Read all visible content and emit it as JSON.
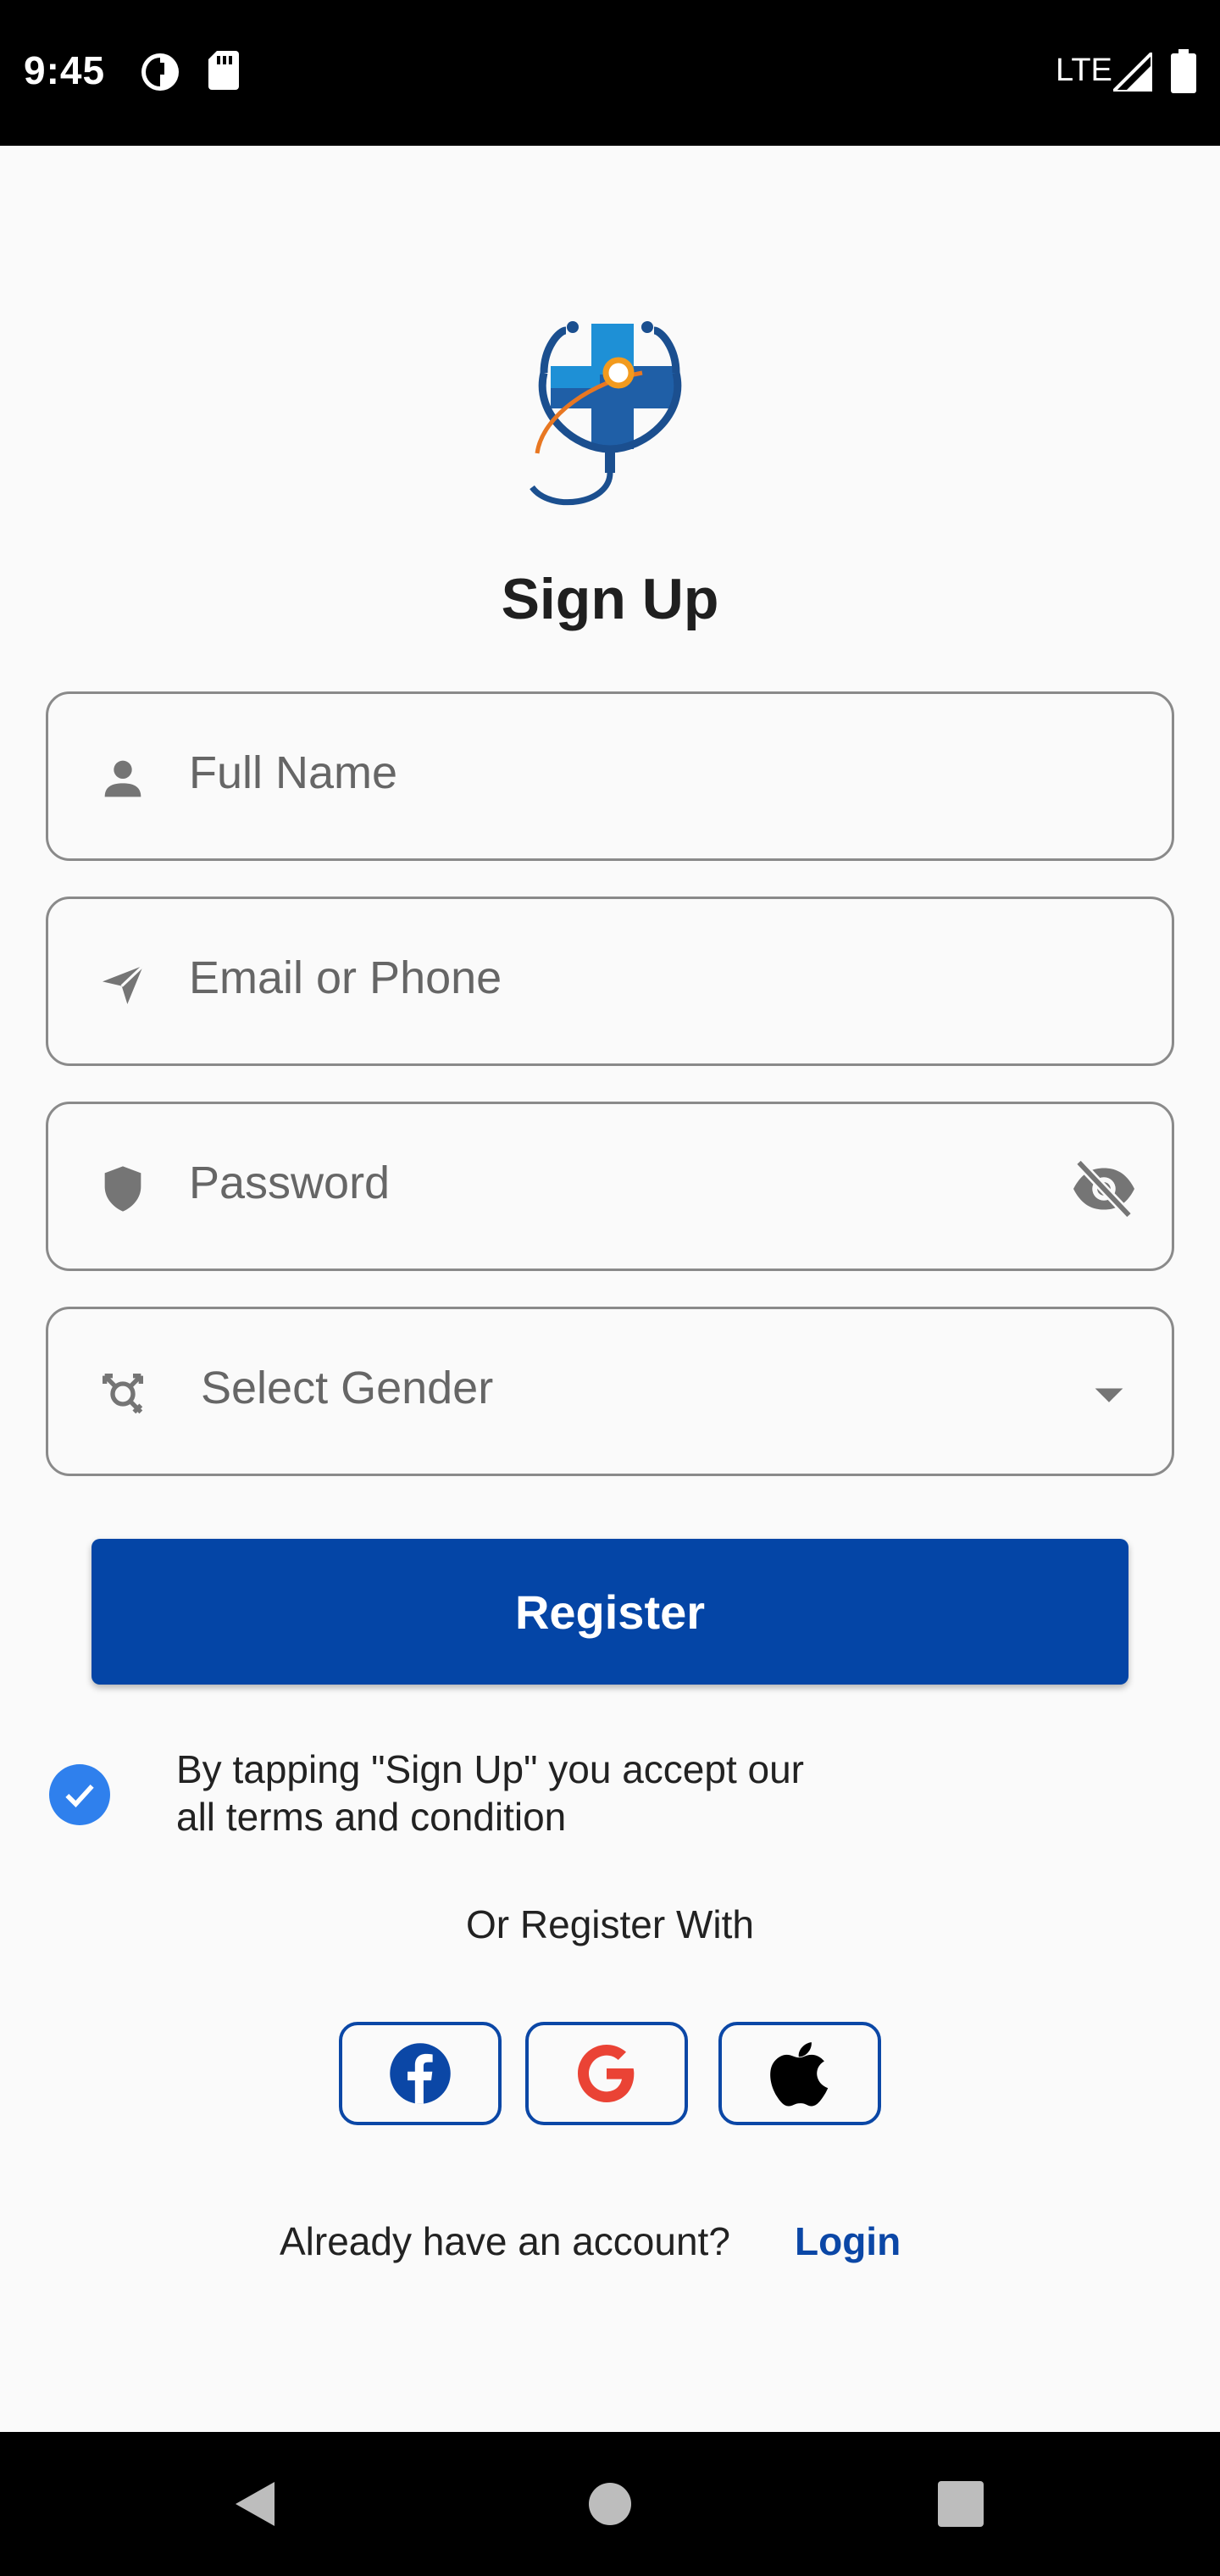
{
  "status_bar": {
    "time": "9:45",
    "network": "LTE",
    "icons": [
      "data-saver-icon",
      "sd-card-icon",
      "signal-icon",
      "battery-icon"
    ]
  },
  "header": {
    "title": "Sign Up"
  },
  "form": {
    "full_name": {
      "placeholder": "Full Name",
      "icon": "person-icon"
    },
    "email": {
      "placeholder": "Email or Phone",
      "icon": "send-icon"
    },
    "password": {
      "placeholder": "Password",
      "icon": "shield-icon",
      "trailing_icon": "visibility-off-icon"
    },
    "gender": {
      "placeholder": "Select Gender",
      "icon": "gender-icon",
      "trailing_icon": "dropdown-arrow-icon"
    }
  },
  "register_button": {
    "label": "Register"
  },
  "terms": {
    "checked": true,
    "line1": "By tapping \"Sign Up\" you accept our",
    "line2": "all terms and condition"
  },
  "social": {
    "heading": "Or Register With",
    "buttons": [
      "facebook-icon",
      "google-icon",
      "apple-icon"
    ]
  },
  "footer": {
    "prompt": "Already have an account?",
    "login_label": "Login"
  },
  "colors": {
    "primary": "#0445a6",
    "checkbox": "#2f80ed",
    "google_red": "#ea4335",
    "facebook_blue": "#0b47a6"
  },
  "nav_bar": {
    "buttons": [
      "back-icon",
      "home-icon",
      "recents-icon"
    ]
  }
}
